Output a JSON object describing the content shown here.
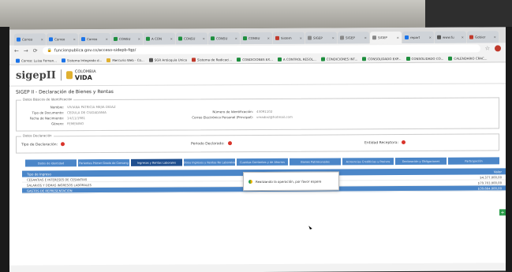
{
  "browser": {
    "tabs": [
      {
        "label": "Correo",
        "color": "#1a73e8",
        "active": false
      },
      {
        "label": "Correo",
        "color": "#1a73e8",
        "active": false
      },
      {
        "label": "Correo",
        "color": "#1a73e8",
        "active": false
      },
      {
        "label": "CONSU",
        "color": "#1e8e3e",
        "active": false
      },
      {
        "label": "A CON",
        "color": "#1e8e3e",
        "active": false
      },
      {
        "label": "CONSU",
        "color": "#1e8e3e",
        "active": false
      },
      {
        "label": "CONSU",
        "color": "#1e8e3e",
        "active": false
      },
      {
        "label": "CONSU",
        "color": "#1e8e3e",
        "active": false
      },
      {
        "label": "Sistem",
        "color": "#c0392b",
        "active": false
      },
      {
        "label": "SIGEP",
        "color": "#888888",
        "active": false
      },
      {
        "label": "SIGEP",
        "color": "#888888",
        "active": false
      },
      {
        "label": "SIGEP",
        "color": "#888888",
        "active": true
      },
      {
        "label": "repart",
        "color": "#1a73e8",
        "active": false
      },
      {
        "label": "www.fu",
        "color": "#555555",
        "active": false
      },
      {
        "label": "Gobier",
        "color": "#c0392b",
        "active": false
      }
    ],
    "url": "funcionpublica.gov.co/acceso-sidepb-fqp/",
    "bookmarks": [
      {
        "label": "Correo: Luisa Fernan...",
        "color": "#1a73e8"
      },
      {
        "label": "Sistema Integrado d...",
        "color": "#1a73e8"
      },
      {
        "label": "Mercurio Web - Co...",
        "color": "#e0b030"
      },
      {
        "label": "SGR Antioquia Unica",
        "color": "#555555"
      },
      {
        "label": "Sistema de Radicaci...",
        "color": "#c0392b"
      },
      {
        "label": "CONDICIONES EX...",
        "color": "#1e8e3e"
      },
      {
        "label": "A CONTROL RESOL...",
        "color": "#1e8e3e"
      },
      {
        "label": "CONDICIONES INT...",
        "color": "#1e8e3e"
      },
      {
        "label": "CONSOLIDADO EXP...",
        "color": "#1e8e3e"
      },
      {
        "label": "CONSOLIDADO CO...",
        "color": "#1e8e3e"
      },
      {
        "label": "CALENDARIO CRAC...",
        "color": "#1e8e3e"
      }
    ]
  },
  "page": {
    "logo": "sigepII",
    "gov_label": "COLOMBIA",
    "gov_brand": "VIDA",
    "title": "SIGEP II - Declaración de Bienes y Rentas",
    "datos_basicos": {
      "legend": "Datos Básicos de Identificación",
      "nombre_label": "Nombre:",
      "nombre_value": "VIVIANA PATRICIA MEJIA DIDAZ",
      "tipo_doc_label": "Tipo de Documento:",
      "tipo_doc_value": "CEDULA DE CIUDADANIA",
      "fecha_nac_label": "Fecha de Nacimiento:",
      "fecha_nac_value": "14/11/1981",
      "genero_label": "Género:",
      "genero_value": "FEMENINO",
      "num_id_label": "Número de Identificación:",
      "num_id_value": "43091102",
      "correo_label": "Correo Electrónico Personal (Principal):",
      "correo_value": "vmadiaz@hotmail.com"
    },
    "datos_declaracion": {
      "legend": "Datos Declaración",
      "tipo_label": "Tipo de Declaración:",
      "periodo_label": "Periodo Declarado:",
      "entidad_label": "Entidad Receptora:"
    },
    "nav_tabs": [
      "Datos de Identidad",
      "Parientes Primer Grado de Consang",
      "Ingresos y Rentas Laborales",
      "Otros Ingresos y Rentas No Laborales",
      "Cuentas Corrientes y de Ahorros",
      "Bienes Patrimoniales",
      "Acreencias Crediticias y Pasivos",
      "Declaración y Obligaciones",
      "Participación"
    ],
    "active_tab": 2,
    "table": {
      "header_left": "Tipo de Ingreso",
      "header_right": "Valor",
      "rows": [
        {
          "label": "CESANTIAS E INTERESES DE CESANTIAS",
          "value": "$4.377.000,00",
          "selected": false
        },
        {
          "label": "SALARIOS Y DEMAS INGRESOS LABORALES",
          "value": "$79.703.000,00",
          "selected": false
        },
        {
          "label": "GASTOS DE REPRESENTACION",
          "value": "$39.664.000,00",
          "selected": true
        }
      ]
    },
    "popup_text": "Realizando la operación, por favor espere"
  }
}
